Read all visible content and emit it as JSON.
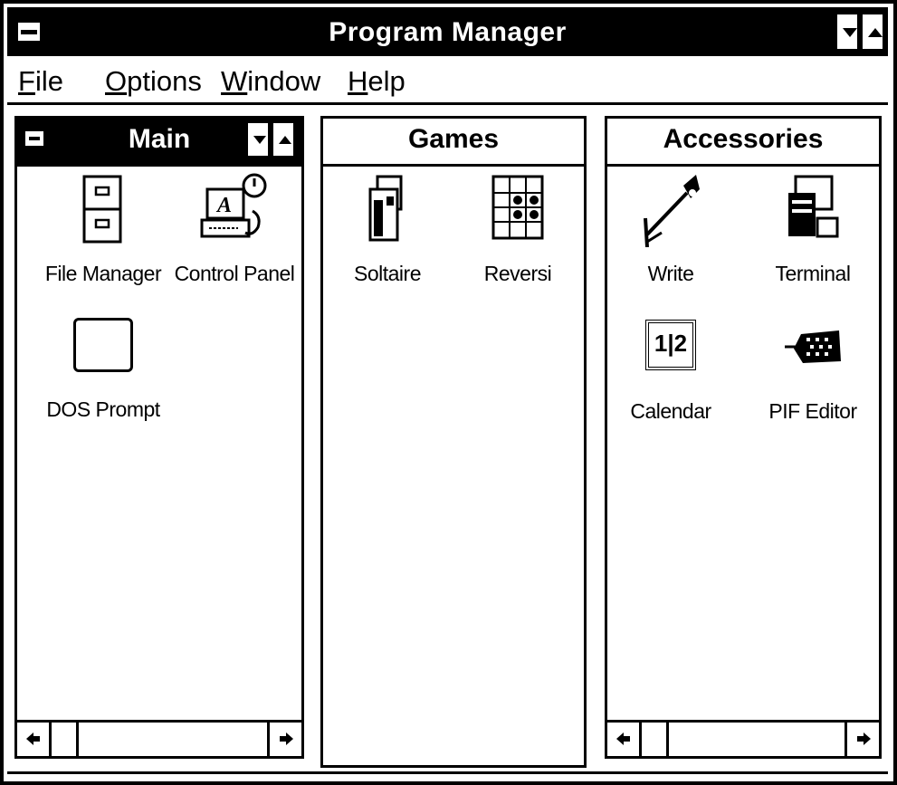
{
  "window": {
    "title": "Program Manager",
    "menu": [
      {
        "label": "File",
        "underline": "F",
        "rest": "ile"
      },
      {
        "label": "Options",
        "underline": "O",
        "rest": "ptions"
      },
      {
        "label": "Window",
        "underline": "W",
        "rest": "indow"
      },
      {
        "label": "Help",
        "underline": "H",
        "rest": "elp"
      }
    ]
  },
  "groups": {
    "main": {
      "title": "Main",
      "icons": [
        "File Manager",
        "Control Panel",
        "DOS Prompt"
      ]
    },
    "games": {
      "title": "Games",
      "icons": [
        "Soltaire",
        "Reversi"
      ]
    },
    "accessories": {
      "title": "Accessories",
      "icons": [
        "Write",
        "Terminal",
        "Calendar",
        "PIF Editor"
      ]
    }
  },
  "calendar_icon_text": "1|2",
  "colors": {
    "titlebar": "#000000",
    "background": "#ffffff",
    "border": "#000000"
  }
}
